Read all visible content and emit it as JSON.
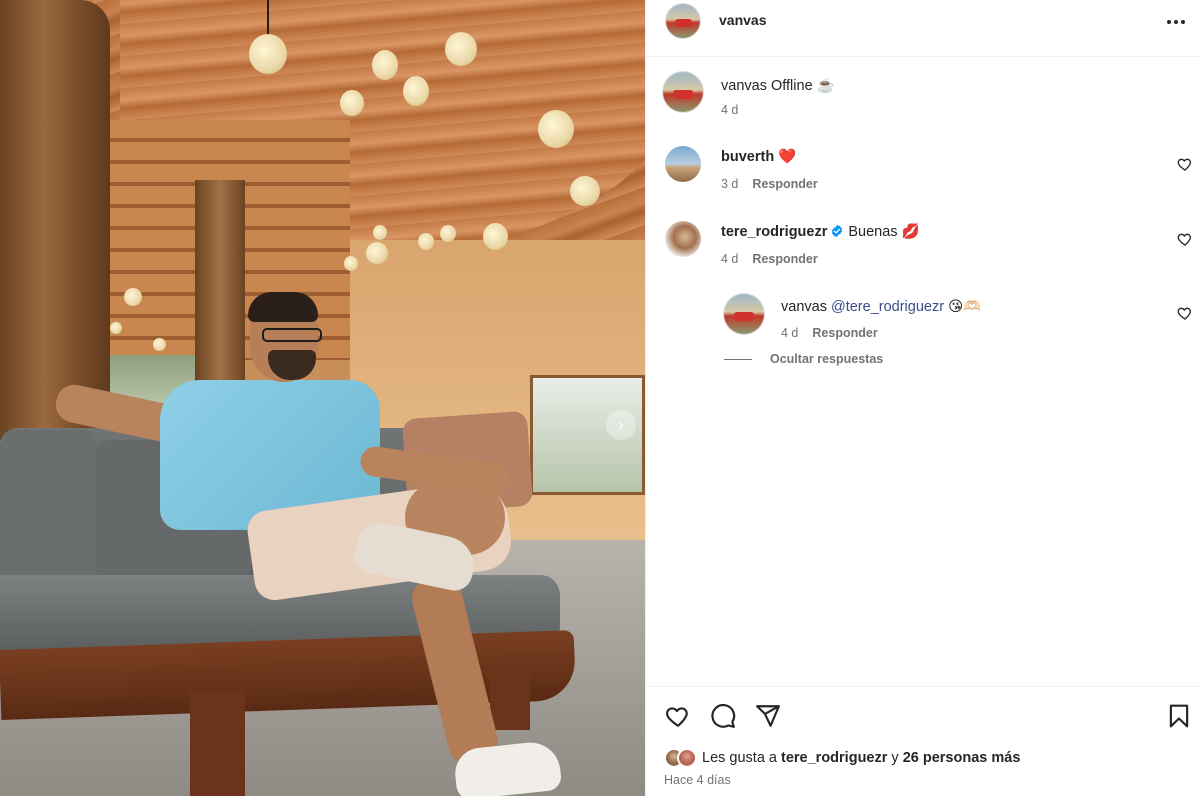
{
  "post": {
    "username": "vanvas"
  },
  "caption": {
    "username": "vanvas",
    "text": "Offline ☕️",
    "time": "4 d"
  },
  "comments": [
    {
      "username": "buverth",
      "text": "❤️",
      "time": "3 d",
      "reply_label": "Responder"
    },
    {
      "username": "tere_rodriguezr",
      "text": "Buenas 💋",
      "time": "4 d",
      "reply_label": "Responder",
      "verified": true
    }
  ],
  "reply": {
    "username": "vanvas",
    "mention": "@tere_rodriguezr",
    "text": "😘🫶🏻",
    "time": "4 d",
    "reply_label": "Responder"
  },
  "hide_replies_label": "Ocultar respuestas",
  "likes": {
    "prefix": "Les gusta a",
    "user": "tere_rodriguezr",
    "connector": "y",
    "others": "26 personas más"
  },
  "time_ago": "Hace 4 días",
  "icons": {
    "more": "more-horizontal-icon",
    "like": "heart-icon",
    "comment": "comment-icon",
    "share": "send-icon",
    "save": "bookmark-icon",
    "carousel_next": "chevron-right-icon"
  },
  "colors": {
    "text": "#262626",
    "secondary": "#737373",
    "mention": "#384c8f",
    "verified": "#0095f6",
    "divider": "#efefef"
  }
}
